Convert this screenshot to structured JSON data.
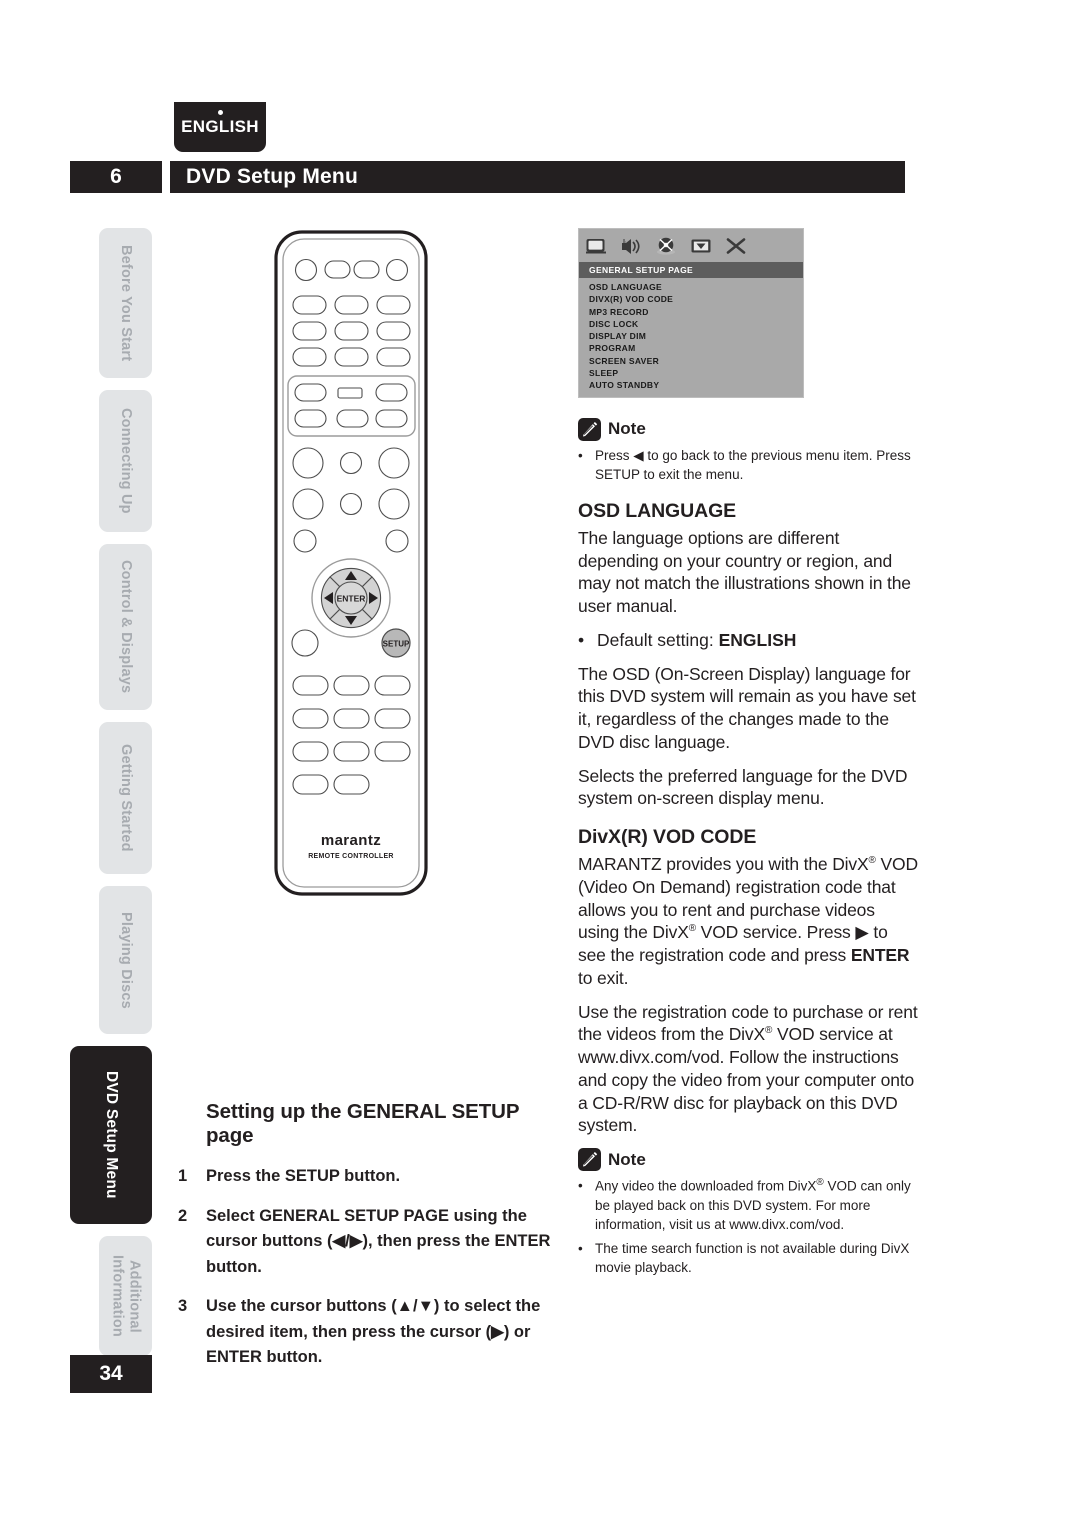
{
  "language_tab": {
    "label": "ENGLISH"
  },
  "header": {
    "chapter_number": "6",
    "title": "DVD Setup Menu"
  },
  "page_number": "34",
  "side_tabs": [
    {
      "label": "Before You Start",
      "active": false
    },
    {
      "label": "Connecting Up",
      "active": false
    },
    {
      "label": "Control & Displays",
      "active": false
    },
    {
      "label": "Getting Started",
      "active": false
    },
    {
      "label": "Playing Discs",
      "active": false
    },
    {
      "label": "DVD Setup Menu",
      "active": true
    },
    {
      "label": "Additional\nInformation",
      "active": false
    }
  ],
  "remote": {
    "enter_label": "ENTER",
    "setup_label": "SETUP",
    "brand": "marantz",
    "subtitle": "REMOTE CONTROLLER"
  },
  "osd_screen": {
    "icons": [
      "tv-monitor-icon",
      "speaker-audio-icon",
      "disc-video-icon",
      "preferences-icon",
      "close-x-icon"
    ],
    "page_title": "GENERAL SETUP PAGE",
    "items": [
      "OSD LANGUAGE",
      "DIVX(R) VOD CODE",
      "MP3 RECORD",
      "DISC LOCK",
      "DISPLAY DIM",
      "PROGRAM",
      "SCREEN SAVER",
      "SLEEP",
      "AUTO STANDBY"
    ],
    "colors": {
      "background": "#a9a9a9",
      "highlight": "#5d5d5d"
    }
  },
  "note_top": {
    "label": "Note",
    "bullets": [
      "Press ◀ to go back to the previous menu item. Press SETUP to exit the menu."
    ]
  },
  "osd_language": {
    "heading": "OSD LANGUAGE",
    "p1": "The language options are different depending on your country or region, and may not match the illustrations shown in the user manual.",
    "bullet_label": "Default setting:",
    "bullet_value": "ENGLISH",
    "p2": "The OSD (On-Screen Display) language for this DVD system will remain as you have set it, regardless of the changes made to the DVD disc language.",
    "p3": "Selects the preferred language for the DVD system on-screen display menu."
  },
  "divx_vod": {
    "heading": "DivX(R) VOD CODE",
    "p1_a": "MARANTZ provides you with the DivX",
    "p1_b": " VOD (Video On Demand) registration code that allows you to rent and purchase videos using the DivX",
    "p1_c": " VOD service. Press ▶ to see the registration code and press ",
    "p1_d": "ENTER",
    "p1_e": " to exit.",
    "p2_a": "Use the registration code to purchase or rent the videos from the DivX",
    "p2_b": " VOD service at www.divx.com/vod. Follow the instructions and copy the video from your computer onto a CD-R/RW disc for playback on this DVD system."
  },
  "note_bottom": {
    "label": "Note",
    "bullet1_a": "Any video the downloaded from DivX",
    "bullet1_b": " VOD can only be played back on this DVD system. For more information, visit us at www.divx.com/vod.",
    "bullet2": "The time search function is not available during DivX movie playback."
  },
  "left_column": {
    "heading": "Setting up the GENERAL SETUP page",
    "steps": [
      {
        "num": "1",
        "text": "Press the SETUP button."
      },
      {
        "num": "2",
        "text": "Select GENERAL SETUP PAGE using the cursor buttons (◀/▶), then press the ENTER button."
      },
      {
        "num": "3",
        "text": "Use the cursor buttons (▲/▼) to select the desired item, then press the cursor (▶) or ENTER button."
      }
    ]
  }
}
